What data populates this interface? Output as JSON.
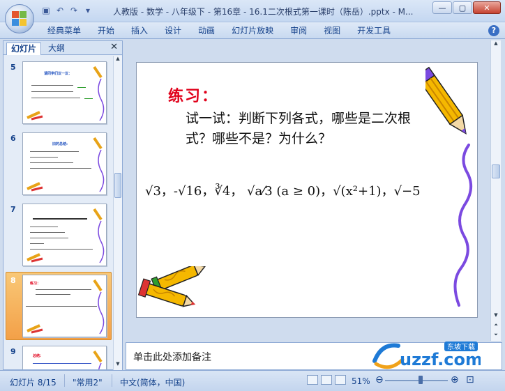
{
  "window": {
    "title": "人教版 - 数学 - 八年级下 - 第16章 - 16.1二次根式第一课时（陈岳）.pptx - M..."
  },
  "quick_access": [
    "save-icon",
    "undo-icon",
    "redo-icon",
    "customize-icon"
  ],
  "ribbon": {
    "tabs": [
      "经典菜单",
      "开始",
      "插入",
      "设计",
      "动画",
      "幻灯片放映",
      "审阅",
      "视图",
      "开发工具"
    ]
  },
  "left_pane": {
    "tabs": [
      "幻灯片",
      "大纲"
    ],
    "close": "✕",
    "thumbnails": [
      {
        "num": "5",
        "title": "请同学们议一议：",
        "selected": false
      },
      {
        "num": "6",
        "title": "旧的总结:",
        "selected": false
      },
      {
        "num": "7",
        "title": "",
        "selected": false
      },
      {
        "num": "8",
        "title": "练习：",
        "selected": true
      },
      {
        "num": "9",
        "title": "总结：",
        "selected": false
      }
    ]
  },
  "slide": {
    "title": "练习：",
    "body": "试一试：判断下列各式，哪些是二次根式？哪些不是？为什么？",
    "math": "√3，-√16，∛4， √a⁄3 (a ≥ 0)，√(x²+1)，√−5"
  },
  "notes": {
    "placeholder": "单击此处添加备注",
    "watermark": "uzzf.com",
    "watermark_tag": "东坡下载"
  },
  "status": {
    "slide_counter": "幻灯片 8/15",
    "theme": "\"常用2\"",
    "language": "中文(简体，中国)",
    "zoom": "51%"
  }
}
